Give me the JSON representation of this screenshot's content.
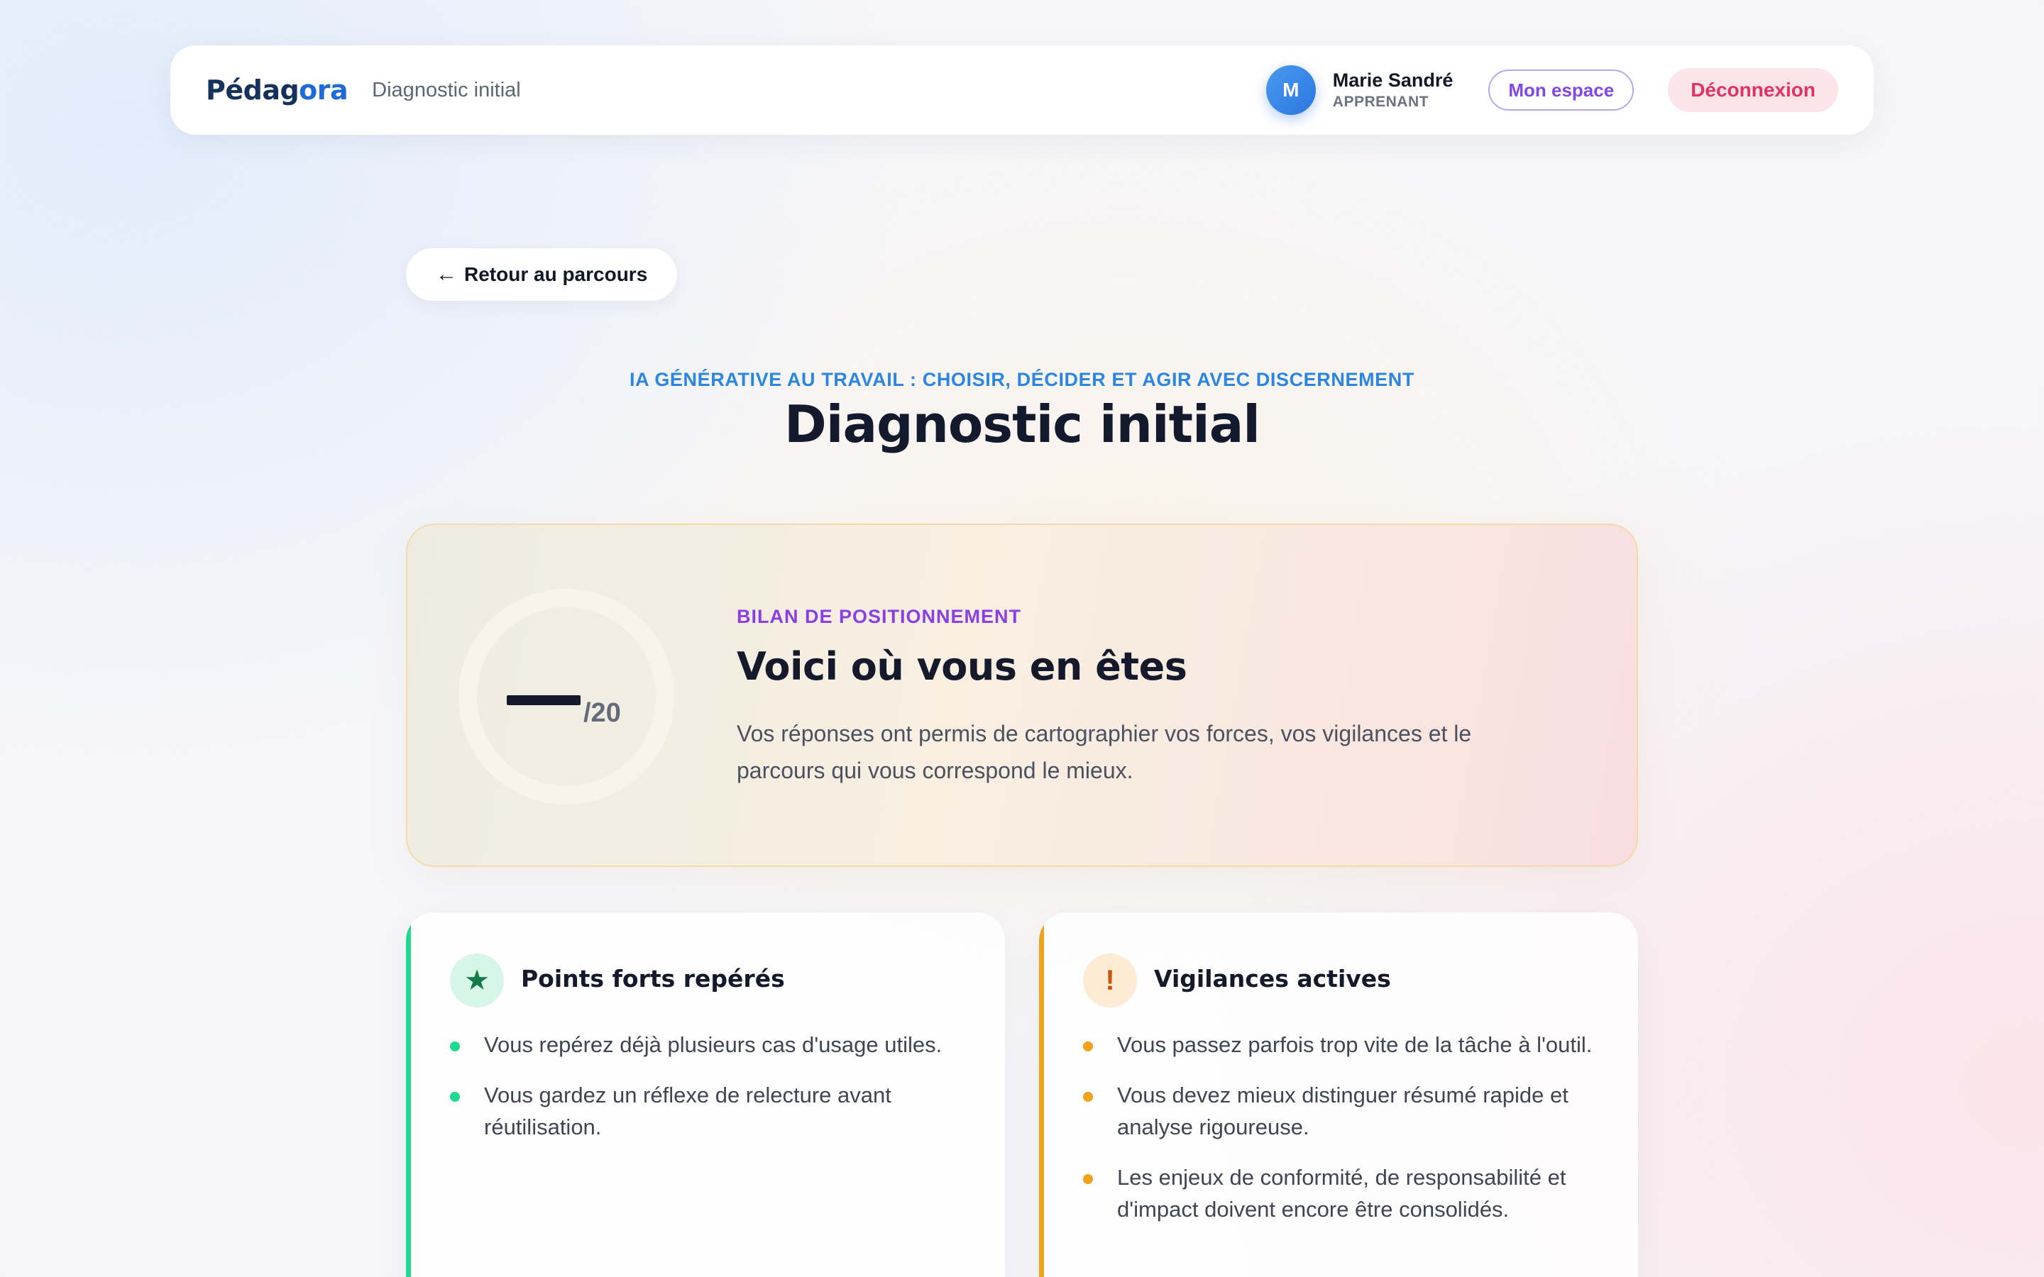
{
  "header": {
    "brand_a": "Pédag",
    "brand_b": "ora",
    "crumb": "Diagnostic initial",
    "user": {
      "initial": "M",
      "name": "Marie Sandré",
      "role": "APPRENANT"
    },
    "space_label": "Mon espace",
    "logout_label": "Déconnexion"
  },
  "back": {
    "arrow": "←",
    "label": "Retour au parcours"
  },
  "page": {
    "eyebrow": "IA GÉNÉRATIVE AU TRAVAIL : CHOISIR, DÉCIDER ET AGIR AVEC DISCERNEMENT",
    "title": "Diagnostic initial"
  },
  "bilan": {
    "score_total": "/20",
    "label": "BILAN DE POSITIONNEMENT",
    "title": "Voici où vous en êtes",
    "text": "Vos réponses ont permis de cartographier vos forces, vos vigilances et le parcours qui vous correspond le mieux."
  },
  "strengths": {
    "icon": "star-icon",
    "icon_glyph": "★",
    "title": "Points forts repérés",
    "items": [
      "Vous repérez déjà plusieurs cas d'usage utiles.",
      "Vous gardez un réflexe de relecture avant réutilisation."
    ]
  },
  "vigilances": {
    "icon": "exclamation-icon",
    "icon_glyph": "!",
    "title": "Vigilances actives",
    "items": [
      "Vous passez parfois trop vite de la tâche à l'outil.",
      "Vous devez mieux distinguer résumé rapide et analyse rigoureuse.",
      "Les enjeux de conformité, de responsabilité et d'impact doivent encore être consolidés."
    ]
  },
  "colors": {
    "accent_blue": "#2b86e3",
    "accent_purple": "#8b3fe2",
    "success_green": "#1ed98f",
    "warning_orange": "#f0a21a",
    "logout_pink": "#e03364"
  }
}
